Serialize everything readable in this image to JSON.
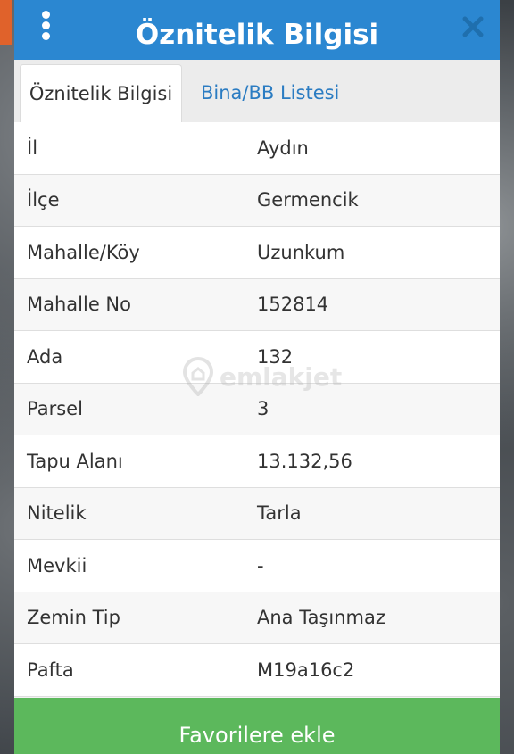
{
  "dialog": {
    "title": "Öznitelik Bilgisi",
    "menu_icon": "kebab-menu-icon",
    "close_icon": "close-icon"
  },
  "tabs": [
    {
      "label": "Öznitelik Bilgisi",
      "active": true
    },
    {
      "label": "Bina/BB Listesi",
      "active": false
    }
  ],
  "attributes": [
    {
      "key": "İl",
      "value": "Aydın"
    },
    {
      "key": "İlçe",
      "value": "Germencik"
    },
    {
      "key": "Mahalle/Köy",
      "value": "Uzunkum"
    },
    {
      "key": "Mahalle No",
      "value": "152814"
    },
    {
      "key": "Ada",
      "value": "132"
    },
    {
      "key": "Parsel",
      "value": "3"
    },
    {
      "key": "Tapu Alanı",
      "value": "13.132,56"
    },
    {
      "key": "Nitelik",
      "value": "Tarla"
    },
    {
      "key": "Mevkii",
      "value": "-"
    },
    {
      "key": "Zemin Tip",
      "value": "Ana Taşınmaz"
    },
    {
      "key": "Pafta",
      "value": "M19a16c2"
    }
  ],
  "watermark": {
    "text": "emlakjet",
    "icon": "location-pin-logo"
  },
  "actions": {
    "favorite_label": "Favorilere ekle"
  },
  "colors": {
    "header": "#2b87d1",
    "tab_link": "#2b7cc2",
    "button": "#5cb85c"
  }
}
